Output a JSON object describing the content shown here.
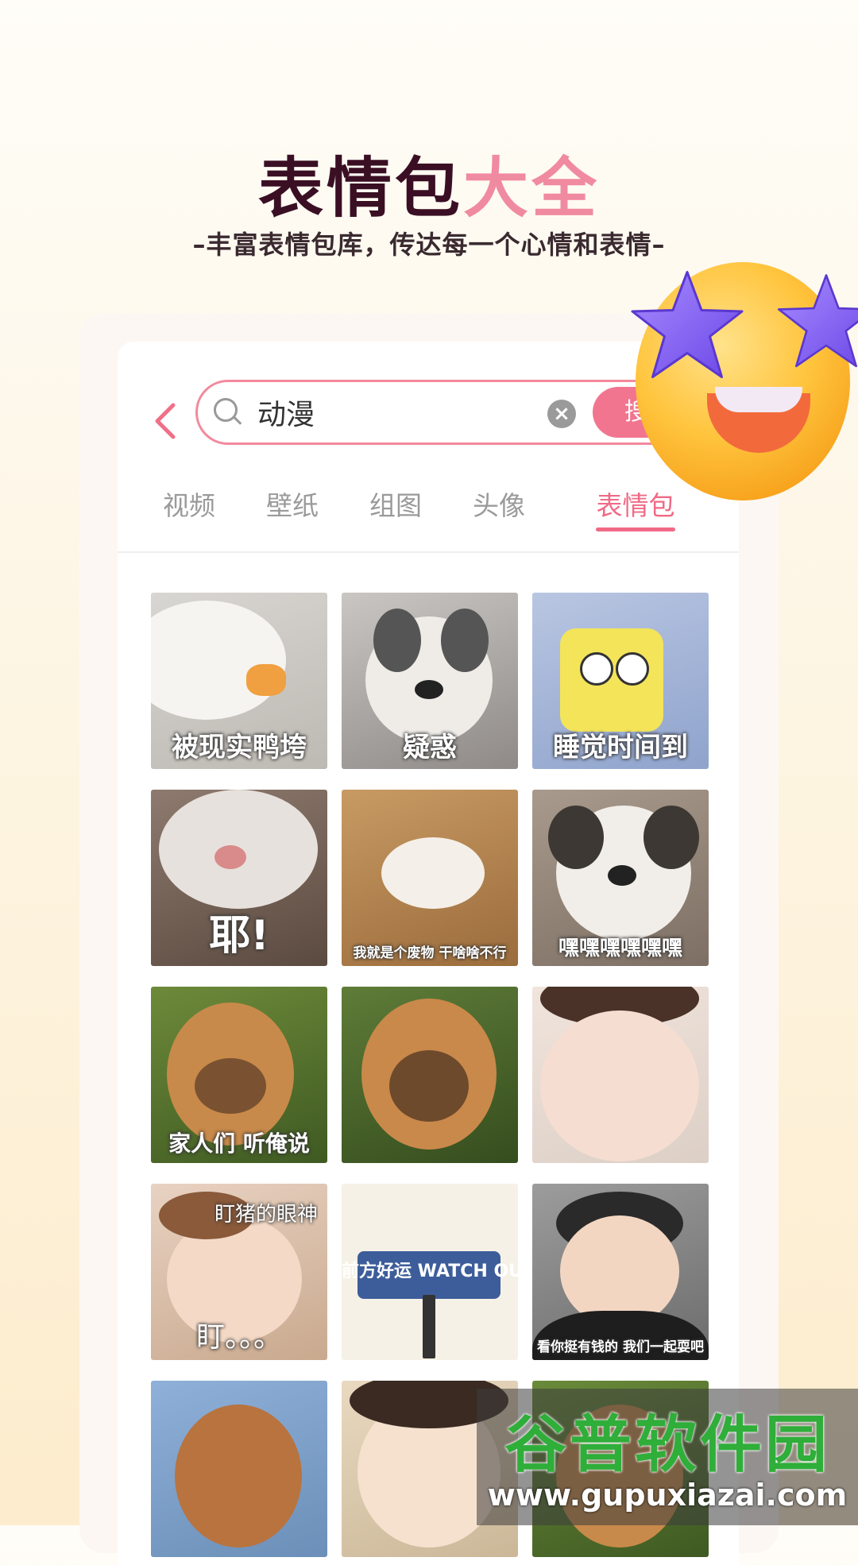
{
  "hero": {
    "title_dark": "表情包",
    "title_pink": "大全",
    "subtitle": "–丰富表情包库，传达每一个心情和表情–"
  },
  "search": {
    "back_icon": "chevron-left-icon",
    "query": "动漫",
    "button_label": "搜"
  },
  "tabs": [
    {
      "label": "视频",
      "active": false
    },
    {
      "label": "壁纸",
      "active": false
    },
    {
      "label": "组图",
      "active": false
    },
    {
      "label": "头像",
      "active": false
    },
    {
      "label": "表情包",
      "active": true
    }
  ],
  "grid": {
    "items": [
      {
        "caption": "被现实鸭垮"
      },
      {
        "caption": "疑惑"
      },
      {
        "caption": "睡觉时间到"
      },
      {
        "caption": "耶!"
      },
      {
        "caption": "我就是个废物 干啥啥不行"
      },
      {
        "caption": "嘿嘿嘿嘿嘿嘿"
      },
      {
        "caption": "家人们 听俺说"
      },
      {
        "caption": ""
      },
      {
        "caption": ""
      },
      {
        "caption": "盯猪的眼神",
        "caption2": "盯。。。"
      },
      {
        "caption": "前方好运 WATCH OUT!"
      },
      {
        "caption": "看你挺有钱的 我们一起耍吧"
      },
      {
        "caption": ""
      },
      {
        "caption": ""
      },
      {
        "caption": ""
      }
    ]
  },
  "watermark": {
    "title": "谷普软件园",
    "url": "www.gupuxiazai.com"
  },
  "colors": {
    "accent_pink": "#f06a86",
    "title_dark": "#3a0f24"
  }
}
